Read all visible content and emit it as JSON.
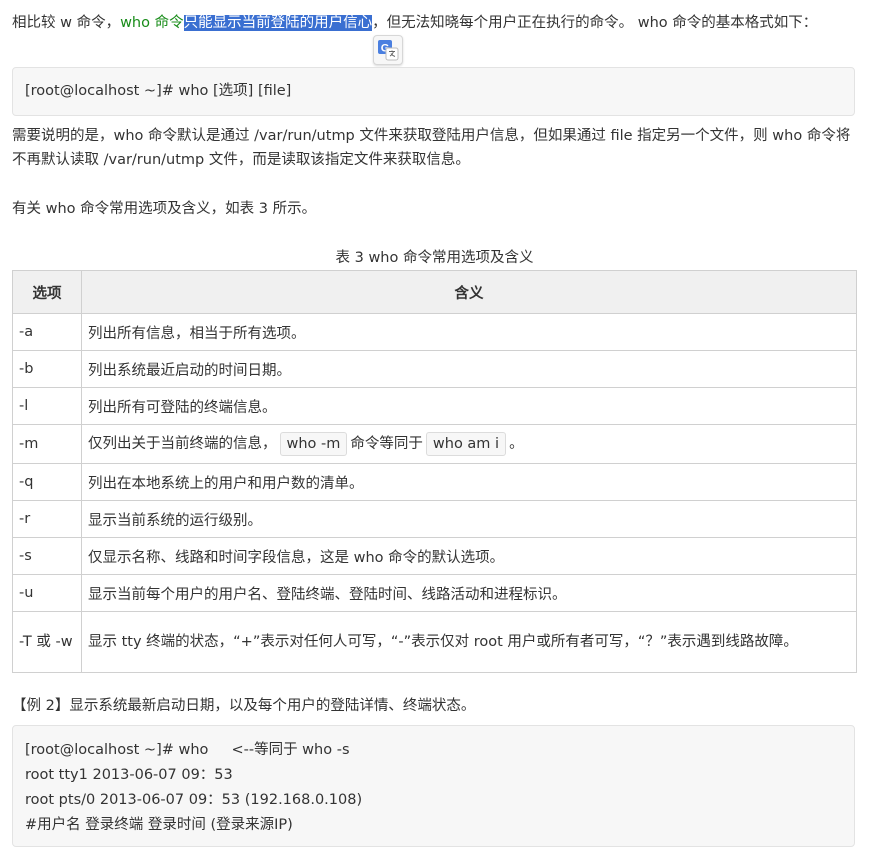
{
  "intro": {
    "prefix": "相比较 w 命令，",
    "green_text": "who 命令",
    "selected_text": "只能显示当前登陆的用户信心",
    "suffix": "，但无法知晓每个用户正在执行的命令。 who 命令的基本格式如下："
  },
  "translate_button": {
    "label": "G",
    "icon": "google-translate-icon",
    "color": "#4a7fe0"
  },
  "syntax_code": [
    "[root@localhost ~]# who [选项] [file]"
  ],
  "note_paragraph": "需要说明的是，who 命令默认是通过 /var/run/utmp 文件来获取登陆用户信息，但如果通过 file 指定另一个文件，则 who 命令将不再默认读取 /var/run/utmp 文件，而是读取该指定文件来获取信息。",
  "options_intro": "有关 who 命令常用选项及含义，如表 3 所示。",
  "table": {
    "caption": "表 3 who 命令常用选项及含义",
    "headers": [
      "选项",
      "含义"
    ],
    "rows": [
      {
        "option": "-a",
        "meaning": "列出所有信息，相当于所有选项。"
      },
      {
        "option": "-b",
        "meaning": "列出系统最近启动的时间日期。"
      },
      {
        "option": "-l",
        "meaning": "列出所有可登陆的终端信息。"
      },
      {
        "option": "-m",
        "meaning_parts": [
          "仅列出关于当前终端的信息，",
          "who -m",
          "命令等同于",
          "who am i",
          "。"
        ]
      },
      {
        "option": "-q",
        "meaning": "列出在本地系统上的用户和用户数的清单。"
      },
      {
        "option": "-r",
        "meaning": "显示当前系统的运行级别。"
      },
      {
        "option": "-s",
        "meaning": "仅显示名称、线路和时间字段信息，这是 who 命令的默认选项。"
      },
      {
        "option": "-u",
        "meaning": "显示当前每个用户的用户名、登陆终端、登陆时间、线路活动和进程标识。"
      },
      {
        "option": "-T 或 -w",
        "meaning": "显示 tty 终端的状态，“+”表示对任何人可写，“-”表示仅对 root 用户或所有者可写，“？”表示遇到线路故障。"
      }
    ]
  },
  "example_heading": "【例 2】显示系统最新启动日期，以及每个用户的登陆详情、终端状态。",
  "example_code": [
    "[root@localhost ~]# who     <--等同于 who -s",
    "root tty1 2013-06-07 09：53",
    "root pts/0 2013-06-07 09：53 (192.168.0.108)",
    "#用户名 登录终端 登录时间 (登录来源IP)"
  ]
}
